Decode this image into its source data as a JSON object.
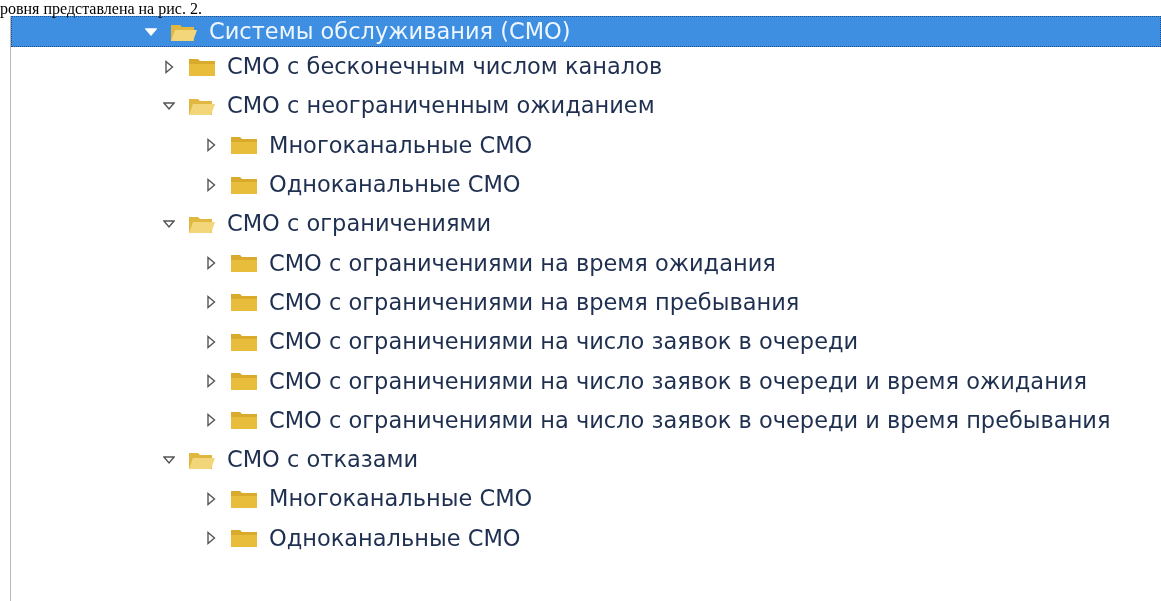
{
  "document_text": "ровня представлена на рис. 2.",
  "tree": [
    {
      "label": "Системы обслуживания (СМО)",
      "expanded": true,
      "selected": true,
      "children": [
        {
          "label": "СМО с бесконечным числом каналов",
          "expanded": false,
          "selected": false
        },
        {
          "label": "СМО с неограниченным ожиданием",
          "expanded": true,
          "selected": false,
          "children": [
            {
              "label": "Многоканальные СМО",
              "expanded": false,
              "selected": false
            },
            {
              "label": "Одноканальные СМО",
              "expanded": false,
              "selected": false
            }
          ]
        },
        {
          "label": "СМО с ограничениями",
          "expanded": true,
          "selected": false,
          "children": [
            {
              "label": "СМО с ограничениями на время ожидания",
              "expanded": false,
              "selected": false
            },
            {
              "label": "СМО с ограничениями на время пребывания",
              "expanded": false,
              "selected": false
            },
            {
              "label": "СМО с ограничениями на число заявок в очереди",
              "expanded": false,
              "selected": false
            },
            {
              "label": "СМО с ограничениями на число заявок в очереди и время ожидания",
              "expanded": false,
              "selected": false
            },
            {
              "label": "СМО с ограничениями на число заявок в очереди и время пребывания",
              "expanded": false,
              "selected": false
            }
          ]
        },
        {
          "label": "СМО с отказами",
          "expanded": true,
          "selected": false,
          "children": [
            {
              "label": "Многоканальные СМО",
              "expanded": false,
              "selected": false
            },
            {
              "label": "Одноканальные СМО",
              "expanded": false,
              "selected": false
            }
          ]
        }
      ]
    }
  ]
}
